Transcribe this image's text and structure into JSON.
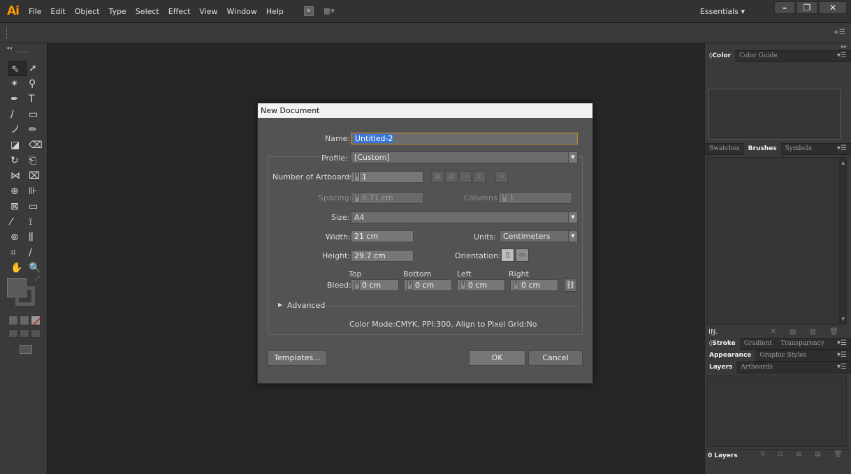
{
  "app": {
    "logo": "Ai",
    "menu": [
      "File",
      "Edit",
      "Object",
      "Type",
      "Select",
      "Effect",
      "View",
      "Window",
      "Help"
    ],
    "bridge_label": "Br",
    "arrange_glyph": "▦▾",
    "workspace": "Essentials ▾",
    "window_controls": [
      "–",
      "❐",
      "✕"
    ]
  },
  "control_bar": {
    "panel_menu": "+☰"
  },
  "tools_panel": {
    "collapse": "◂◂",
    "tools": [
      "⇖",
      "➚",
      "✴",
      "⚲",
      "✒",
      "T",
      "/",
      "▭",
      "ノ",
      "✏",
      "◪",
      "⌫",
      "↻",
      "⎗",
      "⋈",
      "⌧",
      "⊕",
      "⊪",
      "⊠",
      "▭",
      "⁄",
      "⟟",
      "⊚",
      "⫼",
      "⌗",
      "∕",
      "✋",
      "🔍"
    ]
  },
  "right_panels": {
    "expand": "▸▸",
    "color_tabs": [
      "◊Color",
      "Color Guide"
    ],
    "brush_tabs": [
      "Swatches",
      "Brushes",
      "Symbols"
    ],
    "brush_library": "IN̲.",
    "brush_buttons": "✕ ▤ ▥ 🗑",
    "stroke_tabs": [
      "◊Stroke",
      "Gradient",
      "Transparency"
    ],
    "appearance_tabs": [
      "Appearance",
      "Graphic Styles"
    ],
    "layers_tabs": [
      "Layers",
      "Artboards"
    ],
    "layers_count": "0 Layers",
    "layers_buttons": "⚲ ⊡ ⊞ ▤ 🗑",
    "panel_menu": "▾☰"
  },
  "dialog": {
    "title": "New Document",
    "name_label": "Name:",
    "name_value": "Untitled-2",
    "profile_label": "Profile:",
    "profile_value": "[Custom]",
    "artboards_label": "Number of Artboards:",
    "artboards_value": "1",
    "spacing_label": "Spacing:",
    "spacing_value": "0.71 cm",
    "columns_label": "Columns:",
    "columns_value": "1",
    "size_label": "Size:",
    "size_value": "A4",
    "width_label": "Width:",
    "width_value": "21 cm",
    "units_label": "Units:",
    "units_value": "Centimeters",
    "height_label": "Height:",
    "height_value": "29.7 cm",
    "orientation_label": "Orientation:",
    "bleed_label": "Bleed:",
    "bleed_top_label": "Top",
    "bleed_top": "0 cm",
    "bleed_bottom_label": "Bottom",
    "bleed_bottom": "0 cm",
    "bleed_left_label": "Left",
    "bleed_left": "0 cm",
    "bleed_right_label": "Right",
    "bleed_right": "0 cm",
    "advanced_label": "Advanced",
    "info": "Color Mode:CMYK, PPI:300, Align to Pixel Grid:No",
    "templates_button": "Templates...",
    "ok_button": "OK",
    "cancel_button": "Cancel"
  }
}
